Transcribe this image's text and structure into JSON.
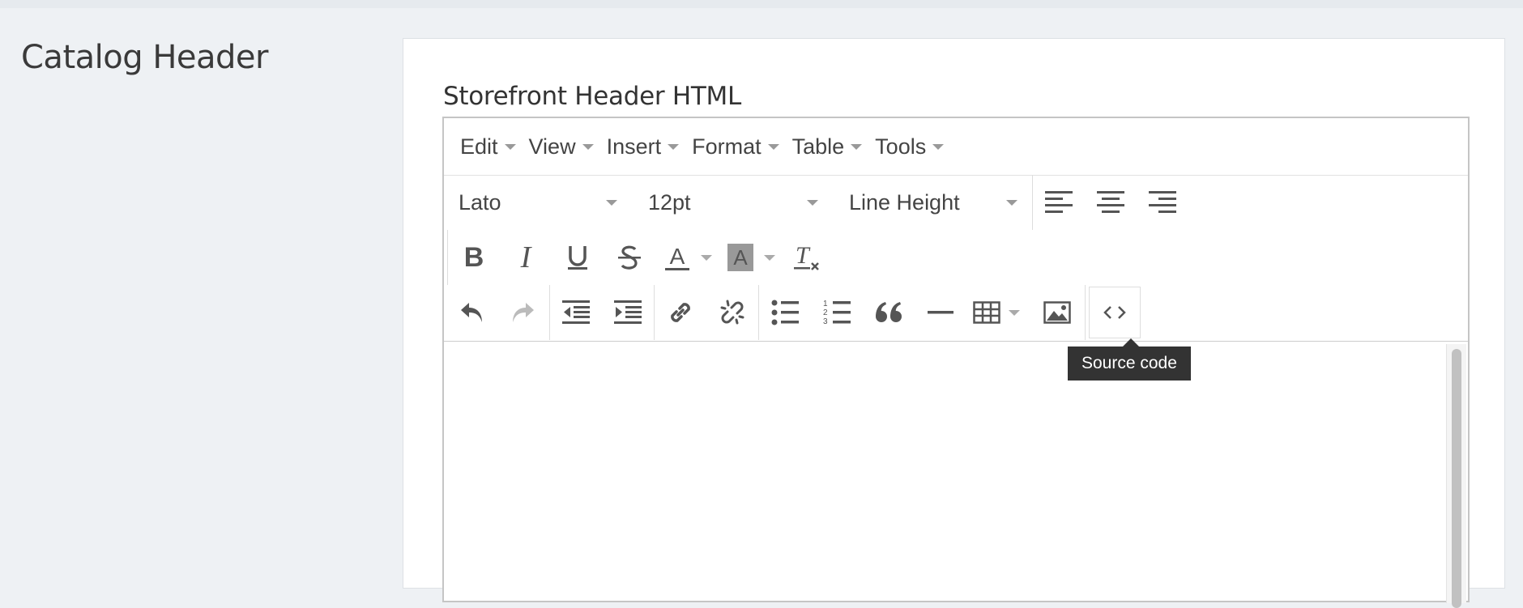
{
  "section": {
    "title": "Catalog Header"
  },
  "field": {
    "label": "Storefront Header HTML"
  },
  "menubar": {
    "items": [
      {
        "label": "Edit"
      },
      {
        "label": "View"
      },
      {
        "label": "Insert"
      },
      {
        "label": "Format"
      },
      {
        "label": "Table"
      },
      {
        "label": "Tools"
      }
    ]
  },
  "toolbar": {
    "font_family": "Lato",
    "font_size": "12pt",
    "line_height": "Line Height",
    "icons": {
      "align_left": "align-left-icon",
      "align_center": "align-center-icon",
      "align_right": "align-right-icon",
      "bold": "bold-icon",
      "italic": "italic-icon",
      "underline": "underline-icon",
      "strikethrough": "strikethrough-icon",
      "text_color": "text-color-icon",
      "background_color": "background-color-icon",
      "clear_formatting": "clear-formatting-icon",
      "undo": "undo-icon",
      "redo": "redo-icon",
      "outdent": "outdent-icon",
      "indent": "indent-icon",
      "link": "link-icon",
      "unlink": "unlink-icon",
      "bullet_list": "bullet-list-icon",
      "numbered_list": "numbered-list-icon",
      "blockquote": "blockquote-icon",
      "horizontal_rule": "horizontal-rule-icon",
      "table": "table-icon",
      "image": "image-icon",
      "source_code": "source-code-icon"
    }
  },
  "tooltip": {
    "text": "Source code"
  },
  "colors": {
    "background": "#eef1f4",
    "tooltip": "#333333",
    "icon": "#555555"
  }
}
